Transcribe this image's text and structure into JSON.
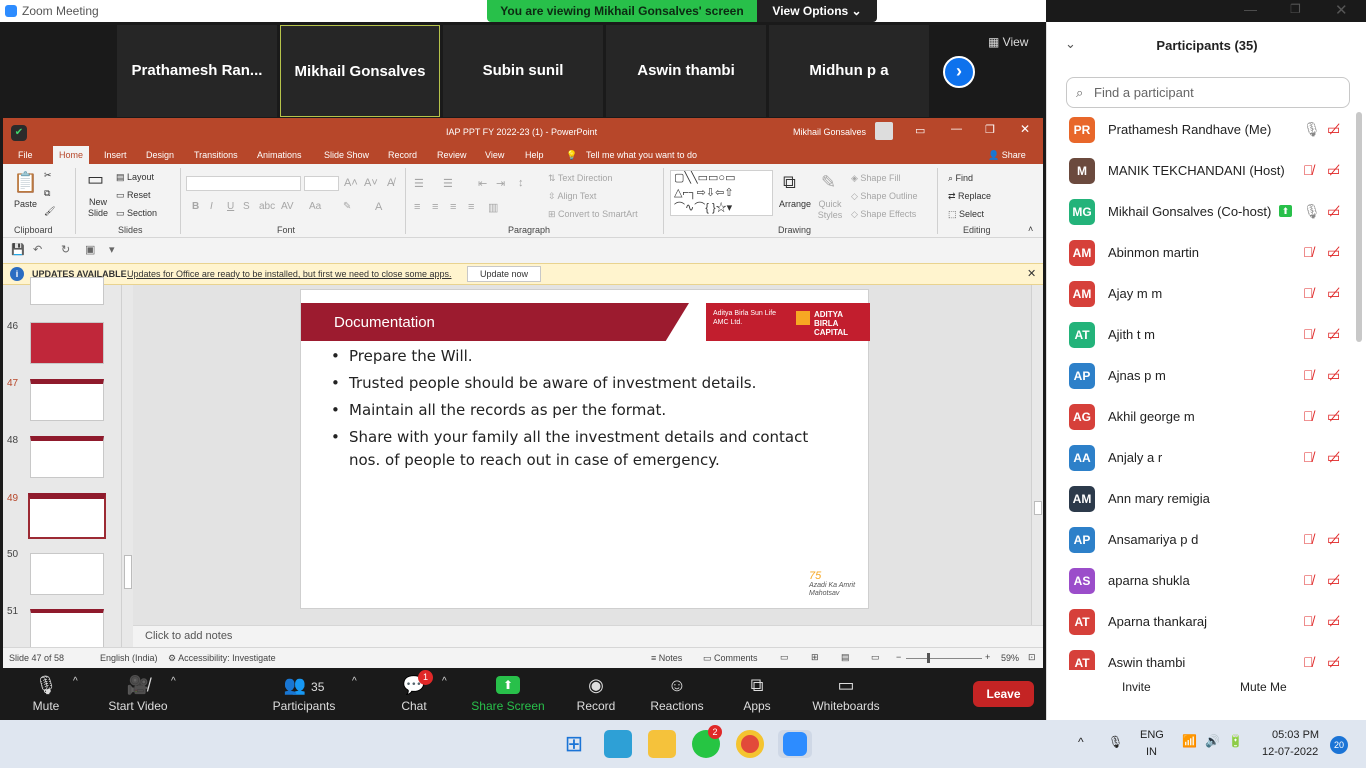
{
  "window": {
    "title": "Zoom Meeting"
  },
  "share_banner": {
    "text": "You are viewing Mikhail Gonsalves' screen",
    "view_options": "View Options ⌄"
  },
  "gallery": {
    "tiles": [
      "Prathamesh  Ran...",
      "Mikhail Gonsalves",
      "Subin sunil",
      "Aswin thambi",
      "Midhun p a"
    ],
    "view_label": "View"
  },
  "powerpoint": {
    "title": "IAP PPT FY 2022-23 (1)  -  PowerPoint",
    "user": "Mikhail Gonsalves",
    "tabs": [
      "File",
      "Home",
      "Insert",
      "Design",
      "Transitions",
      "Animations",
      "Slide Show",
      "Record",
      "Review",
      "View",
      "Help"
    ],
    "tell_me": "Tell me what you want to do",
    "share": "Share",
    "ribbon": {
      "clipboard": {
        "paste": "Paste",
        "label": "Clipboard"
      },
      "slides": {
        "new_slide": "New Slide",
        "layout": "Layout",
        "reset": "Reset",
        "section": "Section",
        "label": "Slides"
      },
      "font": {
        "label": "Font"
      },
      "paragraph": {
        "text_direction": "Text Direction",
        "align_text": "Align Text",
        "convert": "Convert to SmartArt",
        "label": "Paragraph"
      },
      "drawing": {
        "arrange": "Arrange",
        "quick_styles": "Quick Styles",
        "shape_fill": "Shape Fill",
        "shape_outline": "Shape Outline",
        "shape_effects": "Shape Effects",
        "label": "Drawing"
      },
      "editing": {
        "find": "Find",
        "replace": "Replace",
        "select": "Select",
        "label": "Editing"
      }
    },
    "update_bar": {
      "title": "UPDATES AVAILABLE",
      "message": "Updates for Office are ready to be installed, but first we need to close some apps.",
      "button": "Update now"
    },
    "thumbnails": [
      "46",
      "47",
      "48",
      "49",
      "50",
      "51"
    ],
    "slide": {
      "heading": "Documentation",
      "logo_left": "Aditya Birla Sun Life AMC Ltd.",
      "logo_right": "ADITYA BIRLA CAPITAL",
      "bullets": [
        "Prepare the Will.",
        "Trusted people should be aware of investment details.",
        "Maintain all the records as per the format.",
        "Share with your family all the investment details and contact nos. of people to reach out in case of emergency."
      ],
      "footer_logo": "Azadi Ka Amrit Mahotsav"
    },
    "notes_placeholder": "Click to add notes",
    "status": {
      "slide": "Slide 47 of 58",
      "language": "English (India)",
      "accessibility": "Accessibility: Investigate",
      "notes": "Notes",
      "comments": "Comments",
      "zoom": "59%"
    }
  },
  "toolbar": {
    "mute": "Mute",
    "start_video": "Start Video",
    "participants": "Participants",
    "participants_count": "35",
    "chat": "Chat",
    "chat_badge": "1",
    "share_screen": "Share Screen",
    "record": "Record",
    "reactions": "Reactions",
    "apps": "Apps",
    "whiteboards": "Whiteboards",
    "leave": "Leave"
  },
  "participants_panel": {
    "title": "Participants (35)",
    "search_placeholder": "Find a participant",
    "list": [
      {
        "initials": "PR",
        "name": "Prathamesh Randhave (Me)",
        "color": "#e8672a"
      },
      {
        "initials": "M",
        "name": "MANIK TEKCHANDANI (Host)",
        "color": "#6b4a3e"
      },
      {
        "initials": "MG",
        "name": "Mikhail Gonsalves (Co-host)",
        "color": "#23b37a"
      },
      {
        "initials": "AM",
        "name": "Abinmon martin",
        "color": "#d6403a"
      },
      {
        "initials": "AM",
        "name": "Ajay m m",
        "color": "#d6403a"
      },
      {
        "initials": "AT",
        "name": "Ajith t m",
        "color": "#23b37a"
      },
      {
        "initials": "AP",
        "name": "Ajnas p m",
        "color": "#2d80c9"
      },
      {
        "initials": "AG",
        "name": "Akhil george m",
        "color": "#d6403a"
      },
      {
        "initials": "AA",
        "name": "Anjaly a r",
        "color": "#2d80c9"
      },
      {
        "initials": "AM",
        "name": "Ann mary remigia",
        "color": "#2c3a4b"
      },
      {
        "initials": "AP",
        "name": "Ansamariya p d",
        "color": "#2d80c9"
      },
      {
        "initials": "AS",
        "name": "aparna shukla",
        "color": "#9b4dca"
      },
      {
        "initials": "AT",
        "name": "Aparna thankaraj",
        "color": "#d6403a"
      },
      {
        "initials": "AT",
        "name": "Aswin thambi",
        "color": "#d6403a"
      }
    ],
    "invite": "Invite",
    "mute_me": "Mute Me"
  },
  "taskbar": {
    "lang": "ENG",
    "region": "IN",
    "time": "05:03 PM",
    "date": "12-07-2022",
    "notification_count": "20",
    "whatsapp_badge": "2"
  }
}
